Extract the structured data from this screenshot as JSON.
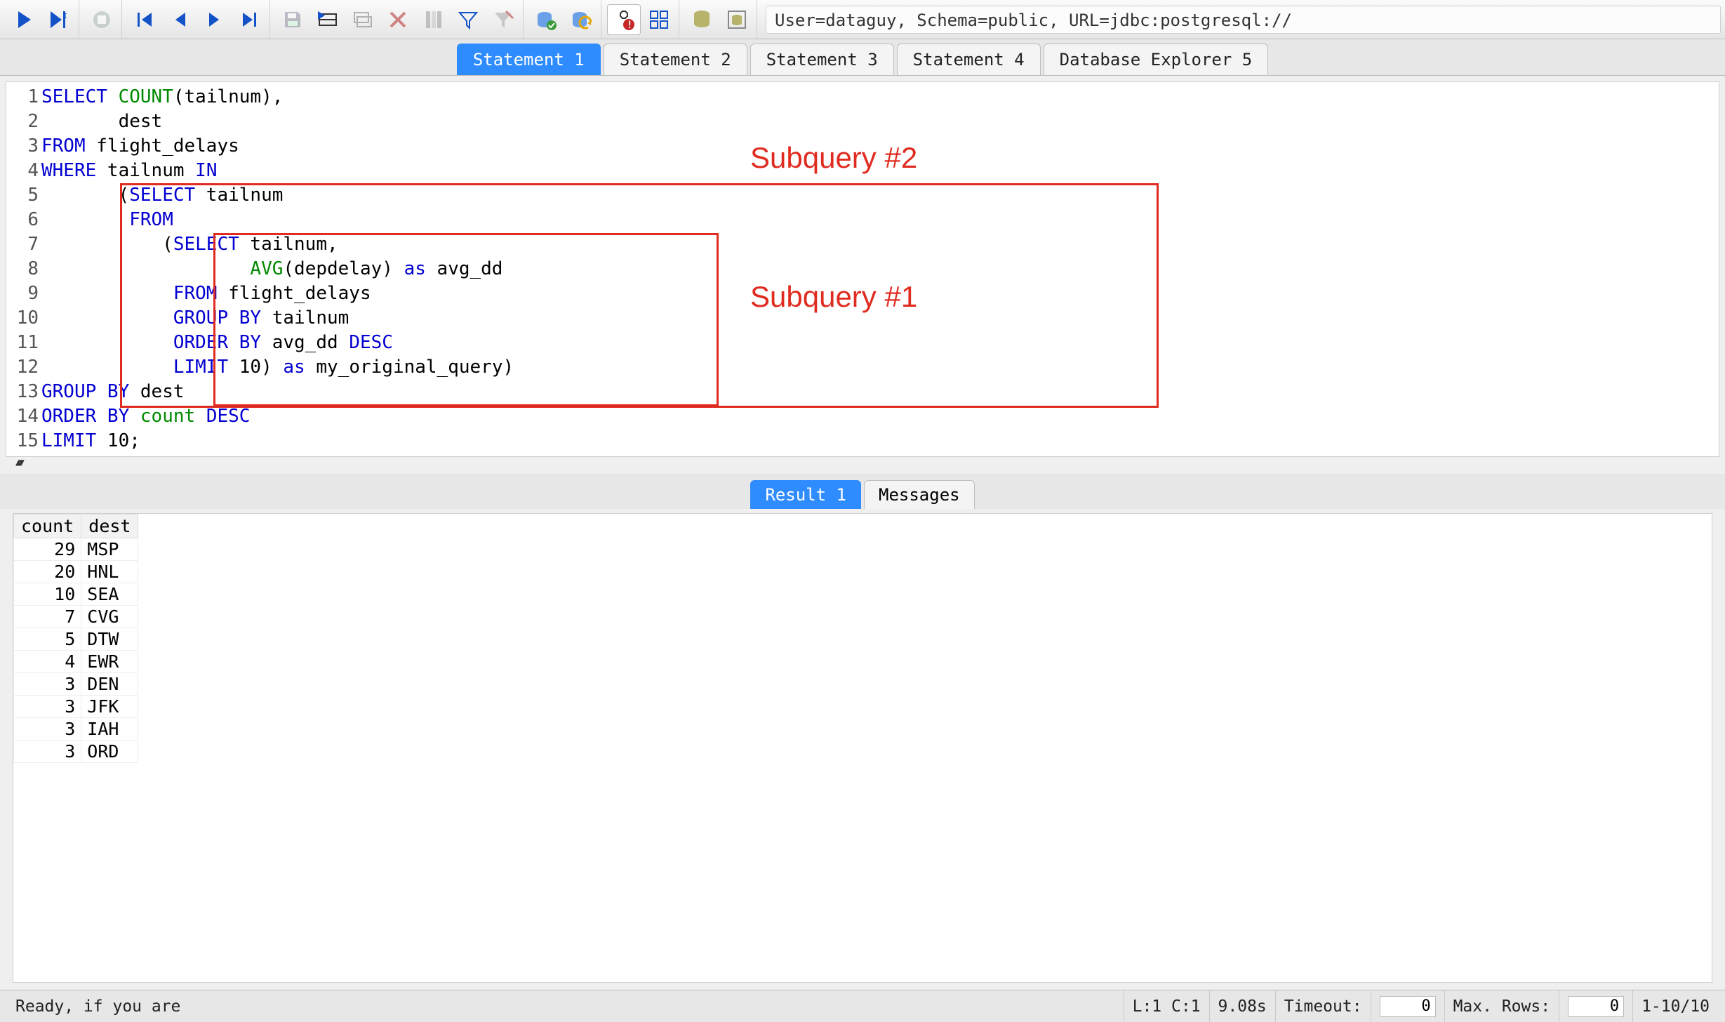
{
  "toolbar": {
    "connection_info": "User=dataguy, Schema=public, URL=jdbc:postgresql://"
  },
  "tabs": [
    {
      "label": "Statement 1",
      "active": true
    },
    {
      "label": "Statement 2",
      "active": false
    },
    {
      "label": "Statement 3",
      "active": false
    },
    {
      "label": "Statement 4",
      "active": false
    },
    {
      "label": "Database Explorer 5",
      "active": false
    }
  ],
  "editor": {
    "lines": [
      {
        "n": "1",
        "tokens": [
          {
            "t": "SELECT",
            "c": "kw"
          },
          {
            "t": " "
          },
          {
            "t": "COUNT",
            "c": "fn"
          },
          {
            "t": "(tailnum),"
          }
        ]
      },
      {
        "n": "2",
        "tokens": [
          {
            "t": "       dest"
          }
        ]
      },
      {
        "n": "3",
        "tokens": [
          {
            "t": "FROM",
            "c": "kw"
          },
          {
            "t": " flight_delays"
          }
        ]
      },
      {
        "n": "4",
        "tokens": [
          {
            "t": "WHERE",
            "c": "kw"
          },
          {
            "t": " tailnum "
          },
          {
            "t": "IN",
            "c": "kw"
          }
        ]
      },
      {
        "n": "5",
        "tokens": [
          {
            "t": "       ("
          },
          {
            "t": "SELECT",
            "c": "kw"
          },
          {
            "t": " tailnum"
          }
        ]
      },
      {
        "n": "6",
        "tokens": [
          {
            "t": "        "
          },
          {
            "t": "FROM",
            "c": "kw"
          }
        ]
      },
      {
        "n": "7",
        "tokens": [
          {
            "t": "           ("
          },
          {
            "t": "SELECT",
            "c": "kw"
          },
          {
            "t": " tailnum,"
          }
        ]
      },
      {
        "n": "8",
        "tokens": [
          {
            "t": "                   "
          },
          {
            "t": "AVG",
            "c": "fn"
          },
          {
            "t": "(depdelay) "
          },
          {
            "t": "as",
            "c": "kw"
          },
          {
            "t": " avg_dd"
          }
        ]
      },
      {
        "n": "9",
        "tokens": [
          {
            "t": "            "
          },
          {
            "t": "FROM",
            "c": "kw"
          },
          {
            "t": " flight_delays"
          }
        ]
      },
      {
        "n": "10",
        "tokens": [
          {
            "t": "            "
          },
          {
            "t": "GROUP BY",
            "c": "kw"
          },
          {
            "t": " tailnum"
          }
        ]
      },
      {
        "n": "11",
        "tokens": [
          {
            "t": "            "
          },
          {
            "t": "ORDER BY",
            "c": "kw"
          },
          {
            "t": " avg_dd "
          },
          {
            "t": "DESC",
            "c": "kw"
          }
        ]
      },
      {
        "n": "12",
        "tokens": [
          {
            "t": "            "
          },
          {
            "t": "LIMIT",
            "c": "kw"
          },
          {
            "t": " 10) "
          },
          {
            "t": "as",
            "c": "kw"
          },
          {
            "t": " my_original_query)"
          }
        ]
      },
      {
        "n": "13",
        "tokens": [
          {
            "t": "GROUP BY",
            "c": "kw"
          },
          {
            "t": " dest"
          }
        ]
      },
      {
        "n": "14",
        "tokens": [
          {
            "t": "ORDER BY",
            "c": "kw"
          },
          {
            "t": " "
          },
          {
            "t": "count",
            "c": "fn"
          },
          {
            "t": " "
          },
          {
            "t": "DESC",
            "c": "kw"
          }
        ]
      },
      {
        "n": "15",
        "tokens": [
          {
            "t": "LIMIT",
            "c": "kw"
          },
          {
            "t": " 10;"
          }
        ]
      }
    ],
    "annotations": {
      "label1": "Subquery #1",
      "label2": "Subquery #2"
    }
  },
  "result_tabs": [
    {
      "label": "Result 1",
      "active": true
    },
    {
      "label": "Messages",
      "active": false
    }
  ],
  "results": {
    "columns": [
      "count",
      "dest"
    ],
    "rows": [
      {
        "count": "29",
        "dest": "MSP"
      },
      {
        "count": "20",
        "dest": "HNL"
      },
      {
        "count": "10",
        "dest": "SEA"
      },
      {
        "count": "7",
        "dest": "CVG"
      },
      {
        "count": "5",
        "dest": "DTW"
      },
      {
        "count": "4",
        "dest": "EWR"
      },
      {
        "count": "3",
        "dest": "DEN"
      },
      {
        "count": "3",
        "dest": "JFK"
      },
      {
        "count": "3",
        "dest": "IAH"
      },
      {
        "count": "3",
        "dest": "ORD"
      }
    ]
  },
  "status": {
    "ready": "Ready, if you are",
    "cursor": "L:1 C:1",
    "time": "9.08s",
    "timeout_label": "Timeout:",
    "timeout_value": "0",
    "maxrows_label": "Max. Rows:",
    "maxrows_value": "0",
    "range": "1-10/10"
  }
}
